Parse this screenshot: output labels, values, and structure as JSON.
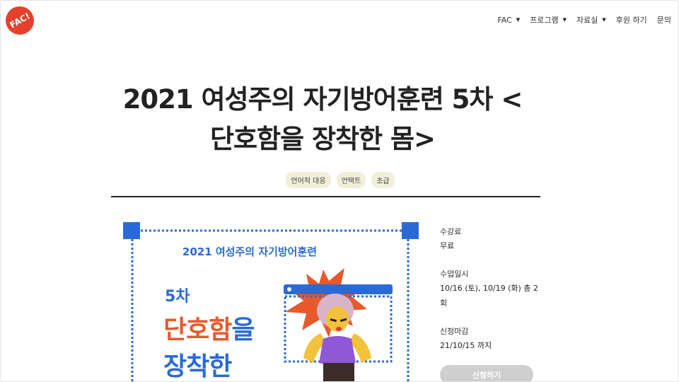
{
  "header": {
    "logo_text": "FAC!",
    "nav": [
      {
        "label": "FAC",
        "has_caret": true
      },
      {
        "label": "프로그램",
        "has_caret": true
      },
      {
        "label": "자료실",
        "has_caret": true
      },
      {
        "label": "후원 하기",
        "has_caret": false
      },
      {
        "label": "문의",
        "has_caret": false
      }
    ]
  },
  "title": {
    "line1": "2021 여성주의 자기방어훈련 5차 <",
    "line2": "단호함을 장착한 몸>"
  },
  "tags": [
    "언어적 대응",
    "언택트",
    "초급"
  ],
  "poster": {
    "subtitle": "2021 여성주의 자기방어훈련",
    "round": "5차",
    "line1_orange": "단호함",
    "line1_blue": "을",
    "line2": "장착한",
    "colors": {
      "blue": "#2a6ad6",
      "orange": "#e8592c",
      "hair": "#d9b4c8",
      "shirt": "#8e58d8",
      "skin": "#f2c23c"
    }
  },
  "info": {
    "fee_label": "수강료",
    "fee_value": "무료",
    "date_label": "수업일시",
    "date_value": "10/16 (토), 10/19 (화) 총 2회",
    "deadline_label": "신청마감",
    "deadline_value": "21/10/15 까지"
  },
  "apply_button": "신청하기",
  "colors": {
    "accent": "#e6402b",
    "tag_bg": "#f2efd9",
    "button_bg": "#cfcfcf"
  }
}
